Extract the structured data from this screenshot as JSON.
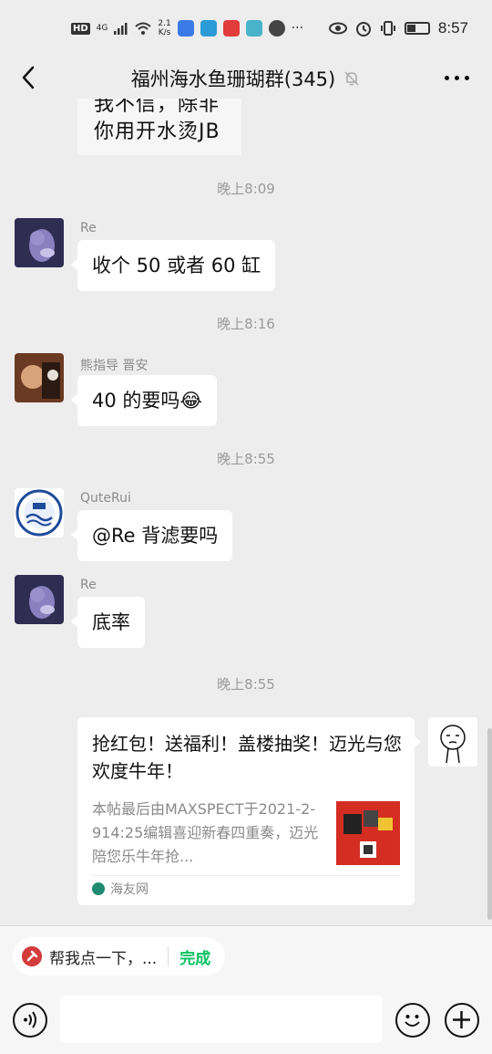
{
  "status_bar": {
    "hd": "HD",
    "network": "4G",
    "speed_value": "2.1",
    "speed_unit": "K/s",
    "more": "···",
    "time": "8:57"
  },
  "header": {
    "title": "福州海水鱼珊瑚群(345)"
  },
  "messages": {
    "partial_image_text": "我不信，除非\n你用开水烫JB",
    "time1": "晚上8:09",
    "msg1": {
      "sender": "Re",
      "text": "收个 50 或者 60 缸"
    },
    "time2": "晚上8:16",
    "msg2": {
      "sender": "熊指导 晋安",
      "text": "40 的要吗",
      "emoji": "😂"
    },
    "time3": "晚上8:55",
    "msg3": {
      "sender": "QuteRui",
      "text": "@Re  背滤要吗"
    },
    "msg4": {
      "sender": "Re",
      "text": "底率"
    },
    "time4": "晚上8:55",
    "card": {
      "title": "抢红包！送福利！盖楼抽奖！迈光与您欢度牛年！",
      "description": "本帖最后由MAXSPECT于2021-2-914:25编辑喜迎新春四重奏，迈光陪您乐牛年抢...",
      "source": "海友网"
    }
  },
  "bottom": {
    "chip_text": "帮我点一下，...",
    "chip_done": "完成",
    "input_value": ""
  },
  "colors": {
    "accent_green": "#07c160",
    "background": "#ededed"
  }
}
